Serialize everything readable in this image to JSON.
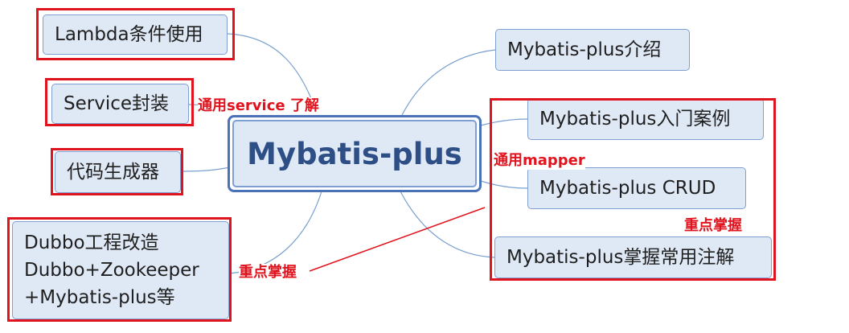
{
  "center": {
    "label": "Mybatis-plus"
  },
  "left_nodes": {
    "lambda": "Lambda条件使用",
    "service": "Service封装",
    "codegen": "代码生成器",
    "dubbo": [
      "Dubbo工程改造",
      "Dubbo+Zookeeper",
      "+Mybatis-plus等"
    ]
  },
  "right_nodes": {
    "intro": "Mybatis-plus介绍",
    "quickstart": "Mybatis-plus入门案例",
    "crud": "Mybatis-plus CRUD",
    "annotations": "Mybatis-plus掌握常用注解"
  },
  "annotations": {
    "service_note": "通用service  了解",
    "mapper_note": "通用mapper",
    "key_note_right": "重点掌握",
    "key_note_left": "重点掌握"
  },
  "colors": {
    "connector": "#7aa0cf",
    "highlight": "#e0141e",
    "node_fill": "#dfe8f5",
    "node_border": "#7f9ed1",
    "center_text": "#2d4f86"
  }
}
